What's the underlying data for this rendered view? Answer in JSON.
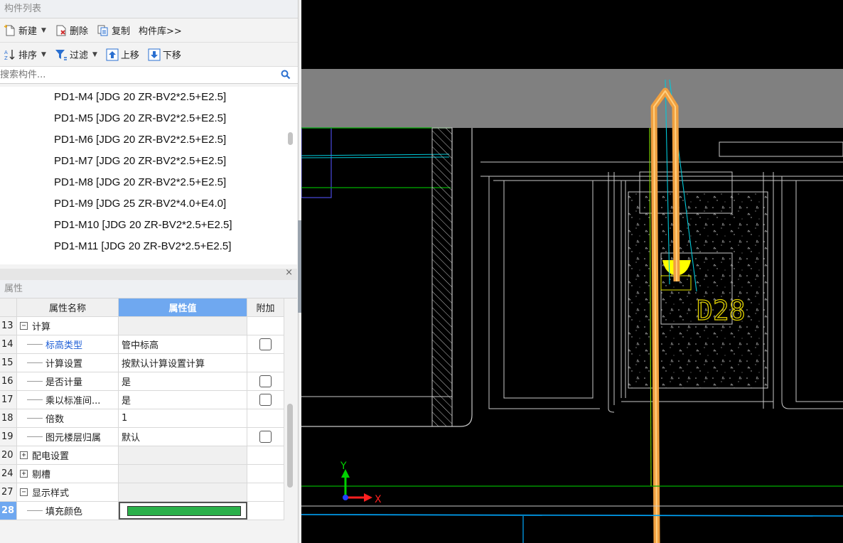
{
  "component_list": {
    "title": "构件列表",
    "toolbar1": {
      "new": "新建",
      "delete": "删除",
      "copy": "复制",
      "library": "构件库>>"
    },
    "toolbar2": {
      "sort": "排序",
      "filter": "过滤",
      "move_up": "上移",
      "move_down": "下移"
    },
    "search_placeholder": "搜索构件...",
    "items": [
      "PD1-M4 [JDG 20 ZR-BV2*2.5+E2.5]",
      "PD1-M5 [JDG 20 ZR-BV2*2.5+E2.5]",
      "PD1-M6 [JDG 20 ZR-BV2*2.5+E2.5]",
      "PD1-M7 [JDG 20 ZR-BV2*2.5+E2.5]",
      "PD1-M8 [JDG 20 ZR-BV2*2.5+E2.5]",
      "PD1-M9 [JDG 25 ZR-BV2*4.0+E4.0]",
      "PD1-M10 [JDG 20 ZR-BV2*2.5+E2.5]",
      "PD1-M11 [JDG 20 ZR-BV2*2.5+E2.5]"
    ]
  },
  "properties": {
    "title": "属性",
    "close": "×",
    "headers": {
      "name": "属性名称",
      "value": "属性值",
      "extra": "附加"
    },
    "rows": [
      {
        "num": "13",
        "name": "计算",
        "value": "",
        "kind": "group",
        "expander": "−",
        "checkbox": false
      },
      {
        "num": "14",
        "name": "标高类型",
        "value": "管中标高",
        "kind": "child-blue",
        "checkbox": true
      },
      {
        "num": "15",
        "name": "计算设置",
        "value": "按默认计算设置计算",
        "kind": "child",
        "checkbox": false
      },
      {
        "num": "16",
        "name": "是否计量",
        "value": "是",
        "kind": "child",
        "checkbox": true
      },
      {
        "num": "17",
        "name": "乘以标准间...",
        "value": "是",
        "kind": "child",
        "checkbox": true
      },
      {
        "num": "18",
        "name": "倍数",
        "value": "1",
        "kind": "child",
        "checkbox": false
      },
      {
        "num": "19",
        "name": "图元楼层归属",
        "value": "默认",
        "kind": "child",
        "checkbox": true
      },
      {
        "num": "20",
        "name": "配电设置",
        "value": "",
        "kind": "group",
        "expander": "+",
        "checkbox": false
      },
      {
        "num": "24",
        "name": "剔槽",
        "value": "",
        "kind": "group",
        "expander": "+",
        "checkbox": false
      },
      {
        "num": "27",
        "name": "显示样式",
        "value": "",
        "kind": "group",
        "expander": "−",
        "checkbox": false
      },
      {
        "num": "28",
        "name": "填充颜色",
        "value": "",
        "kind": "color",
        "checkbox": false
      }
    ],
    "fill_color": "#2bb04a"
  },
  "cad": {
    "label": "D28",
    "axis_x": "X",
    "axis_y": "Y",
    "colors": {
      "pipe": "#f0a040",
      "highlight": "#ffff00",
      "cyan": "#00c8d8",
      "green": "#00a800",
      "grey_band": "#808080"
    }
  }
}
